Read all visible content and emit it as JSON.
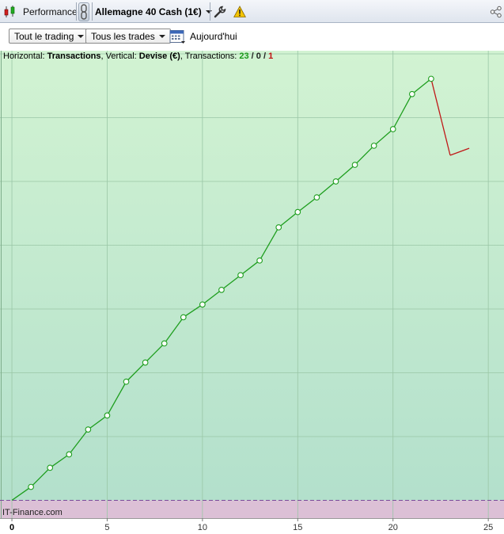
{
  "toolbar": {
    "performance_label": "Performance",
    "instrument_label": "Allemagne 40 Cash (1€)"
  },
  "filters": {
    "trading_label": "Tout le trading",
    "trades_label": "Tous les trades",
    "date_label": "Aujourd'hui"
  },
  "info": {
    "prefix": "Horizontal: ",
    "horizontal": "Transactions",
    "vertical_prefix": ", Vertical: ",
    "vertical": "Devise (€)",
    "transactions_prefix": ", Transactions: ",
    "wins": "23",
    "sep1": " / ",
    "neutral": "0",
    "sep2": " / ",
    "losses": "1"
  },
  "source": "IT-Finance.com",
  "colors": {
    "gain_line": "#1e9e1e",
    "loss_line": "#c01818",
    "positive_bg_top": "#d2f3d2",
    "positive_bg_bottom": "#b3e0cc",
    "negative_bg": "#dcc0d6",
    "zero_line": "#7a4a9a"
  },
  "chart_data": {
    "type": "line",
    "x": [
      0,
      1,
      2,
      3,
      4,
      5,
      6,
      7,
      8,
      9,
      10,
      11,
      12,
      13,
      14,
      15,
      16,
      17,
      18,
      19,
      20,
      21,
      22,
      23,
      24
    ],
    "y": [
      0,
      21,
      51,
      72,
      111,
      133,
      186,
      216,
      246,
      287,
      307,
      330,
      353,
      376,
      428,
      452,
      475,
      500,
      526,
      556,
      582,
      637,
      661,
      541,
      552
    ],
    "markers_to_index": 22,
    "loss_from_index": 22,
    "xticks": [
      "0",
      "5",
      "10",
      "15",
      "20",
      "25"
    ],
    "xlim": [
      -0.5,
      25.7
    ],
    "ylim": [
      -28,
      705
    ],
    "grid": true
  }
}
